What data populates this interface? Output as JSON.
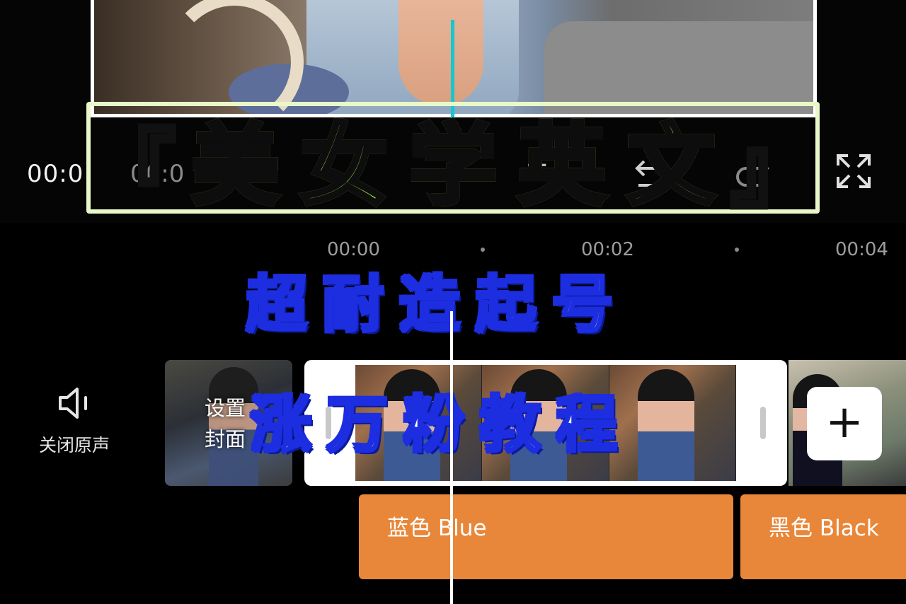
{
  "preview": {
    "current_time": "00:0",
    "total_time": "00:0"
  },
  "title_banner": {
    "text": "美女学英文",
    "left_bracket": "『",
    "right_bracket": "』"
  },
  "ruler": {
    "ticks": [
      "00:00",
      "00:02",
      "00:04"
    ]
  },
  "captions": {
    "line1": "超耐造起号",
    "line2": "涨万粉教程"
  },
  "audio": {
    "mute_label": "关闭原声",
    "icon": "speaker-icon"
  },
  "cover": {
    "label": "设置\n封面"
  },
  "clip": {
    "frames": 3,
    "add_label": "+"
  },
  "text_tracks": [
    {
      "label": "蓝色  Blue"
    },
    {
      "label": "黑色  Black"
    }
  ],
  "colors": {
    "title_green": "#a6f04a",
    "caption_blue": "#1c2ee0",
    "track_orange": "#e8873a",
    "playhead_cyan": "#16c6d0"
  }
}
